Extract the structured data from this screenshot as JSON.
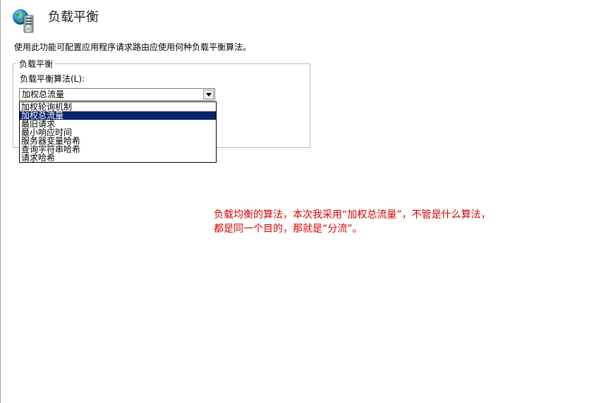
{
  "header": {
    "icon": "globe-server-icon",
    "title": "负载平衡"
  },
  "description": "使用此功能可配置应用程序请求路由应使用何种负载平衡算法。",
  "group": {
    "legend": "负载平衡",
    "algorithm_label": "负载平衡算法(L):",
    "selected_value": "加权总流量",
    "options": [
      "加权轮询机制",
      "加权总流量",
      "最旧请求",
      "最小响应时间",
      "服务器变量哈希",
      "查询字符串哈希",
      "请求哈希"
    ],
    "highlighted_index": 1
  },
  "annotation": {
    "line1": "负载均衡的算法，本次我采用“加权总流量”，不管是什么算法，",
    "line2": "都是同一个目的，那就是“分流”。",
    "color": "#d40000"
  },
  "colors": {
    "selection_bg": "#0a246a",
    "groupbox_border": "#b9b9b9"
  }
}
